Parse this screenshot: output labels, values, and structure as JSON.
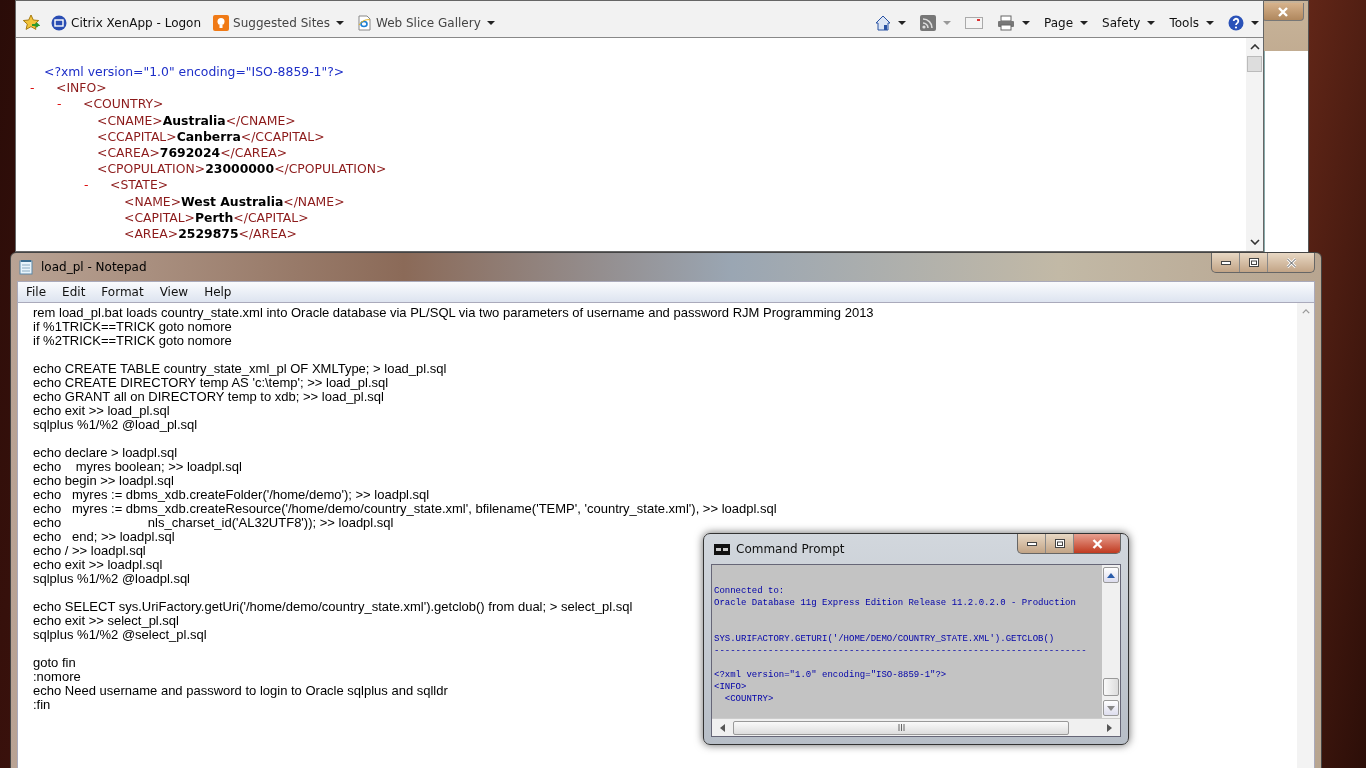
{
  "browser": {
    "favorites_bar": [
      {
        "kind": "citrix",
        "label": "Citrix XenApp - Logon",
        "dropdown": false
      },
      {
        "kind": "bulb",
        "label": "Suggested Sites",
        "dropdown": true
      },
      {
        "kind": "slice",
        "label": "Web Slice Gallery",
        "dropdown": true
      }
    ],
    "command_bar": [
      {
        "kind": "home",
        "dropdown": true
      },
      {
        "kind": "rss",
        "dropdown": true
      },
      {
        "kind": "mail",
        "dropdown": false
      },
      {
        "kind": "print",
        "dropdown": true
      },
      {
        "kind": "text",
        "label": "Page",
        "dropdown": true
      },
      {
        "kind": "text",
        "label": "Safety",
        "dropdown": true
      },
      {
        "kind": "text",
        "label": "Tools",
        "dropdown": true
      },
      {
        "kind": "help",
        "dropdown": true
      }
    ],
    "xml": {
      "declaration": "<?xml version=\"1.0\" encoding=\"ISO-8859-1\"?>",
      "root": {
        "toggle": "-",
        "open": "<INFO>",
        "children": [
          {
            "toggle": "-",
            "open": "<COUNTRY>",
            "children": [
              {
                "open": "<CNAME>",
                "value": "Australia",
                "close": "</CNAME>"
              },
              {
                "open": "<CCAPITAL>",
                "value": "Canberra",
                "close": "</CCAPITAL>"
              },
              {
                "open": "<CAREA>",
                "value": "7692024",
                "close": "</CAREA>"
              },
              {
                "open": "<CPOPULATION>",
                "value": "23000000",
                "close": "</CPOPULATION>"
              },
              {
                "toggle": "-",
                "open": "<STATE>",
                "children": [
                  {
                    "open": "<NAME>",
                    "value": "West Australia",
                    "close": "</NAME>"
                  },
                  {
                    "open": "<CAPITAL>",
                    "value": "Perth",
                    "close": "</CAPITAL>"
                  },
                  {
                    "open": "<AREA>",
                    "value": "2529875",
                    "close": "</AREA>"
                  }
                ]
              }
            ]
          }
        ]
      }
    }
  },
  "notepad": {
    "title": "load_pl - Notepad",
    "menu": [
      "File",
      "Edit",
      "Format",
      "View",
      "Help"
    ],
    "paragraphs": [
      [
        "rem load_pl.bat loads country_state.xml into Oracle database via PL/SQL via two parameters of username and password RJM Programming 2013",
        "if %1TRICK==TRICK goto nomore",
        "if %2TRICK==TRICK goto nomore"
      ],
      [
        "echo CREATE TABLE country_state_xml_pl OF XMLType; > load_pl.sql",
        "echo CREATE DIRECTORY temp AS 'c:\\temp'; >> load_pl.sql",
        "echo GRANT all on DIRECTORY temp to xdb; >> load_pl.sql",
        "echo exit >> load_pl.sql",
        "sqlplus %1/%2 @load_pl.sql"
      ],
      [
        "echo declare > loadpl.sql",
        "echo    myres boolean; >> loadpl.sql",
        "echo begin >> loadpl.sql",
        "echo   myres := dbms_xdb.createFolder('/home/demo'); >> loadpl.sql",
        "echo   myres := dbms_xdb.createResource('/home/demo/country_state.xml', bfilename('TEMP', 'country_state.xml'), >> loadpl.sql",
        "echo                        nls_charset_id('AL32UTF8')); >> loadpl.sql",
        "echo   end; >> loadpl.sql",
        "echo / >> loadpl.sql",
        "echo exit >> loadpl.sql",
        "sqlplus %1/%2 @loadpl.sql"
      ],
      [
        "echo SELECT sys.UriFactory.getUri('/home/demo/country_state.xml').getclob() from dual; > select_pl.sql",
        "echo exit >> select_pl.sql",
        "sqlplus %1/%2 @select_pl.sql"
      ],
      [
        "goto fin",
        ":nomore",
        "echo Need username and password to login to Oracle sqlplus and sqlldr",
        ":fin"
      ]
    ]
  },
  "command_prompt": {
    "title": "Command Prompt",
    "paragraphs": [
      [
        "Connected to:",
        "Oracle Database 11g Express Edition Release 11.2.0.2.0 - Production"
      ],
      [
        "SYS.URIFACTORY.GETURI('/HOME/DEMO/COUNTRY_STATE.XML').GETCLOB()",
        "---------------------------------------------------------------------"
      ],
      [
        "<?xml version=\"1.0\" encoding=\"ISO-8859-1\"?>",
        "<INFO>",
        "  <COUNTRY>"
      ]
    ]
  }
}
